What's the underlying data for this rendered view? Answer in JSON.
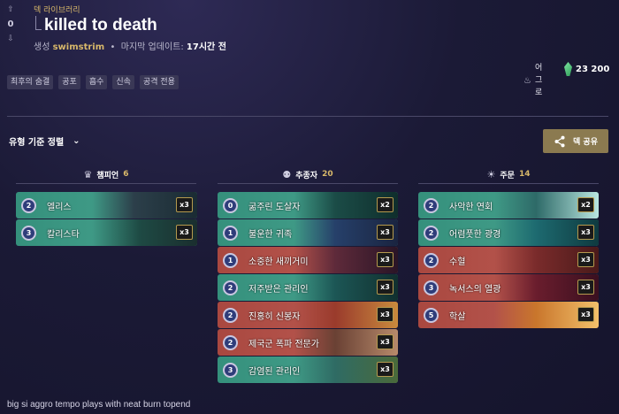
{
  "vote": {
    "up": "⇧",
    "count": "0",
    "down": "⇩"
  },
  "breadcrumb": "덱 라이브러리",
  "deck_title": "killed to death",
  "meta": {
    "created_by_label": "생성",
    "author": "swimstrim",
    "separator": "•",
    "updated_label": "마지막 업데이트:",
    "updated_value": "17시간 전"
  },
  "tags": [
    "최후의 숨결",
    "공포",
    "흡수",
    "신속",
    "공격 전용"
  ],
  "playstyle": {
    "chars": [
      "어",
      "그",
      "로"
    ],
    "icon": "fire-icon"
  },
  "shards": {
    "value": "23 200",
    "icon": "shard-gem-icon"
  },
  "sort_label": "유형 기준 정렬",
  "share_label": "덱 공유",
  "columns": [
    {
      "label": "챔피언",
      "count": "6",
      "icon": "champion-helm-icon"
    },
    {
      "label": "추종자",
      "count": "20",
      "icon": "follower-icon"
    },
    {
      "label": "주문",
      "count": "14",
      "icon": "spell-icon"
    }
  ],
  "champions": [
    {
      "cost": "2",
      "name": "엘리스",
      "qty": "x3"
    },
    {
      "cost": "3",
      "name": "칼리스타",
      "qty": "x3"
    }
  ],
  "followers": [
    {
      "cost": "0",
      "name": "굶주린 도살자",
      "qty": "x2"
    },
    {
      "cost": "1",
      "name": "불운한 귀족",
      "qty": "x3"
    },
    {
      "cost": "1",
      "name": "소중한 새끼거미",
      "qty": "x3"
    },
    {
      "cost": "2",
      "name": "저주받은 관리인",
      "qty": "x3"
    },
    {
      "cost": "2",
      "name": "진홍히 신봉자",
      "qty": "x3"
    },
    {
      "cost": "2",
      "name": "제국군 폭파 전문가",
      "qty": "x3"
    },
    {
      "cost": "3",
      "name": "감염된 관리인",
      "qty": "x3"
    }
  ],
  "spells": [
    {
      "cost": "2",
      "name": "사악한 연회",
      "qty": "x2"
    },
    {
      "cost": "2",
      "name": "어렴풋한 광경",
      "qty": "x3"
    },
    {
      "cost": "2",
      "name": "수혈",
      "qty": "x3"
    },
    {
      "cost": "3",
      "name": "녹서스의 열광",
      "qty": "x3"
    },
    {
      "cost": "5",
      "name": "학살",
      "qty": "x3"
    }
  ],
  "description": "big si aggro tempo plays with neat burn topend",
  "colors": {
    "shadow_isles": "#3f9a86",
    "noxus": "#b3524a",
    "gold": "#d8b86a",
    "share_bg": "#8b7a50"
  }
}
